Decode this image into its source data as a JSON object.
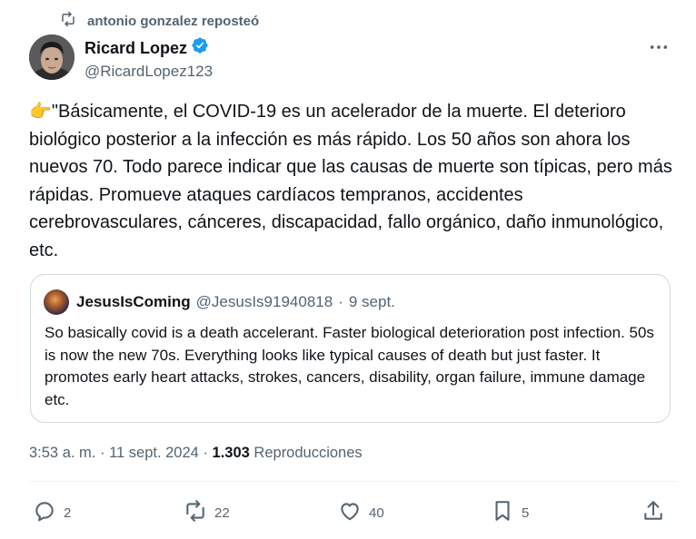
{
  "repost": {
    "text": "antonio gonzalez reposteó",
    "icon": "repost-icon"
  },
  "author": {
    "name": "Ricard Lopez",
    "handle": "@RicardLopez123",
    "verified_icon": "verified-badge-icon",
    "avatar_icon": "avatar-photo"
  },
  "post": {
    "emoji": "👉",
    "text": "\"Básicamente, el COVID-19 es un acelerador de la muerte. El deterioro biológico posterior a la infección es más rápido. Los 50 años son ahora los nuevos 70. Todo parece indicar que las causas de muerte son típicas, pero más rápidas. Promueve ataques cardíacos tempranos, accidentes cerebrovasculares, cánceres, discapacidad, fallo orgánico, daño inmunológico, etc."
  },
  "quote": {
    "name": "JesusIsComing",
    "handle": "@JesusIs91940818",
    "separator": "·",
    "date": "9 sept.",
    "text": "So basically covid is a death accelerant. Faster biological deterioration post infection. 50s is now the new 70s. Everything looks like typical causes of death but just faster. It promotes early heart attacks, strokes, cancers, disability, organ failure, immune damage etc."
  },
  "meta": {
    "time": "3:53 a. m.",
    "sep1": "·",
    "date": "11 sept. 2024",
    "sep2": "·",
    "views_count": "1.303",
    "views_label": "Reproducciones"
  },
  "actions": {
    "replies": "2",
    "reposts": "22",
    "likes": "40",
    "bookmarks": "5"
  },
  "colors": {
    "text_primary": "#0f1419",
    "text_secondary": "#536471",
    "verified_blue": "#1d9bf0",
    "border": "#cfd9de"
  }
}
